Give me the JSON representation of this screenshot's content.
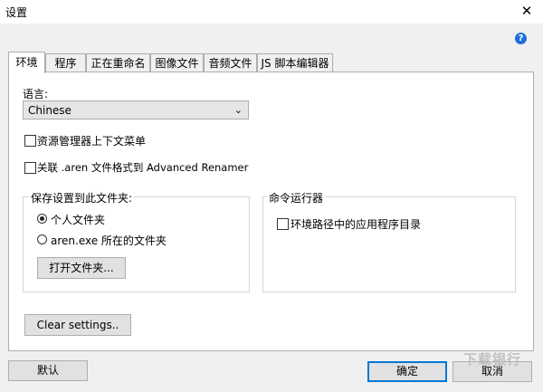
{
  "window": {
    "title": "设置",
    "close_glyph": "✕"
  },
  "help_glyph": "?",
  "tabs": [
    {
      "label": "环境",
      "active": true
    },
    {
      "label": "程序",
      "active": false
    },
    {
      "label": "正在重命名",
      "active": false
    },
    {
      "label": "图像文件",
      "active": false
    },
    {
      "label": "音频文件",
      "active": false
    },
    {
      "label": "JS 脚本编辑器",
      "active": false
    }
  ],
  "environment": {
    "language_label": "语言:",
    "language_value": "Chinese",
    "checkbox_context_menu": {
      "label": "资源管理器上下文菜单",
      "checked": false
    },
    "checkbox_associate": {
      "label": "关联 .aren 文件格式到 Advanced Renamer",
      "checked": false
    },
    "save_group": {
      "title": "保存设置到此文件夹:",
      "options": [
        {
          "label": "个人文件夹",
          "selected": true
        },
        {
          "label": "aren.exe 所在的文件夹",
          "selected": false
        }
      ],
      "open_folder_button": "打开文件夹..."
    },
    "command_group": {
      "title": "命令运行器",
      "checkbox_env_path": {
        "label": "环境路径中的应用程序目录",
        "checked": false
      }
    },
    "clear_settings_button": "Clear settings.."
  },
  "footer": {
    "default_button": "默认",
    "ok_button": "确定",
    "cancel_button": "取消"
  },
  "watermark_text": "下载银行"
}
